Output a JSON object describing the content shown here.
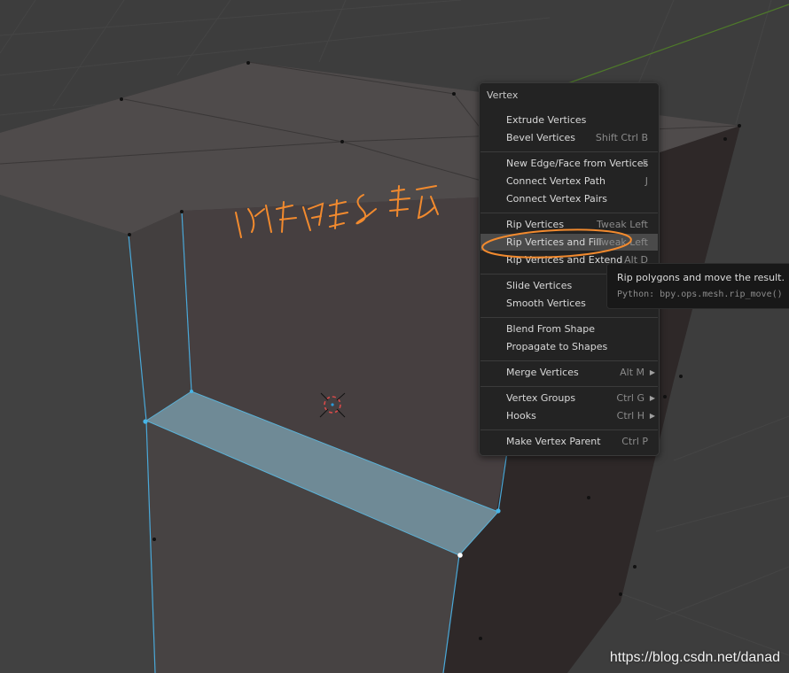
{
  "menu": {
    "title": "Vertex",
    "items": [
      {
        "label": "Extrude Vertices",
        "shortcut": ""
      },
      {
        "label": "Bevel Vertices",
        "shortcut": "Shift Ctrl B"
      },
      {
        "label": "New Edge/Face from Vertices",
        "shortcut": "F"
      },
      {
        "label": "Connect Vertex Path",
        "shortcut": "J"
      },
      {
        "label": "Connect Vertex Pairs",
        "shortcut": ""
      },
      {
        "label": "Rip Vertices",
        "shortcut": "Tweak Left"
      },
      {
        "label": "Rip Vertices and Fill",
        "shortcut": "Tweak Left"
      },
      {
        "label": "Rip Vertices and Extend",
        "shortcut": "Alt D"
      },
      {
        "label": "Slide Vertices",
        "shortcut": ""
      },
      {
        "label": "Smooth Vertices",
        "shortcut": ""
      },
      {
        "label": "Blend From Shape",
        "shortcut": ""
      },
      {
        "label": "Propagate to Shapes",
        "shortcut": ""
      },
      {
        "label": "Merge Vertices",
        "shortcut": "Alt M"
      },
      {
        "label": "Vertex Groups",
        "shortcut": "Ctrl G"
      },
      {
        "label": "Hooks",
        "shortcut": "Ctrl H"
      },
      {
        "label": "Make Vertex Parent",
        "shortcut": "Ctrl P"
      }
    ]
  },
  "tooltip": {
    "description": "Rip polygons and move the result.",
    "python": "Python: bpy.ops.mesh.rip_move()"
  },
  "annotation": {
    "text": "断离顶点 & 填充",
    "color": "#f28a2e"
  },
  "watermark": "https://blog.csdn.net/danad",
  "colors": {
    "viewport_bg": "#3d3d3d",
    "menu_bg": "#232323",
    "highlight": "#4a4a4a",
    "selection": "#4aa8d8",
    "annotation": "#f28a2e"
  }
}
